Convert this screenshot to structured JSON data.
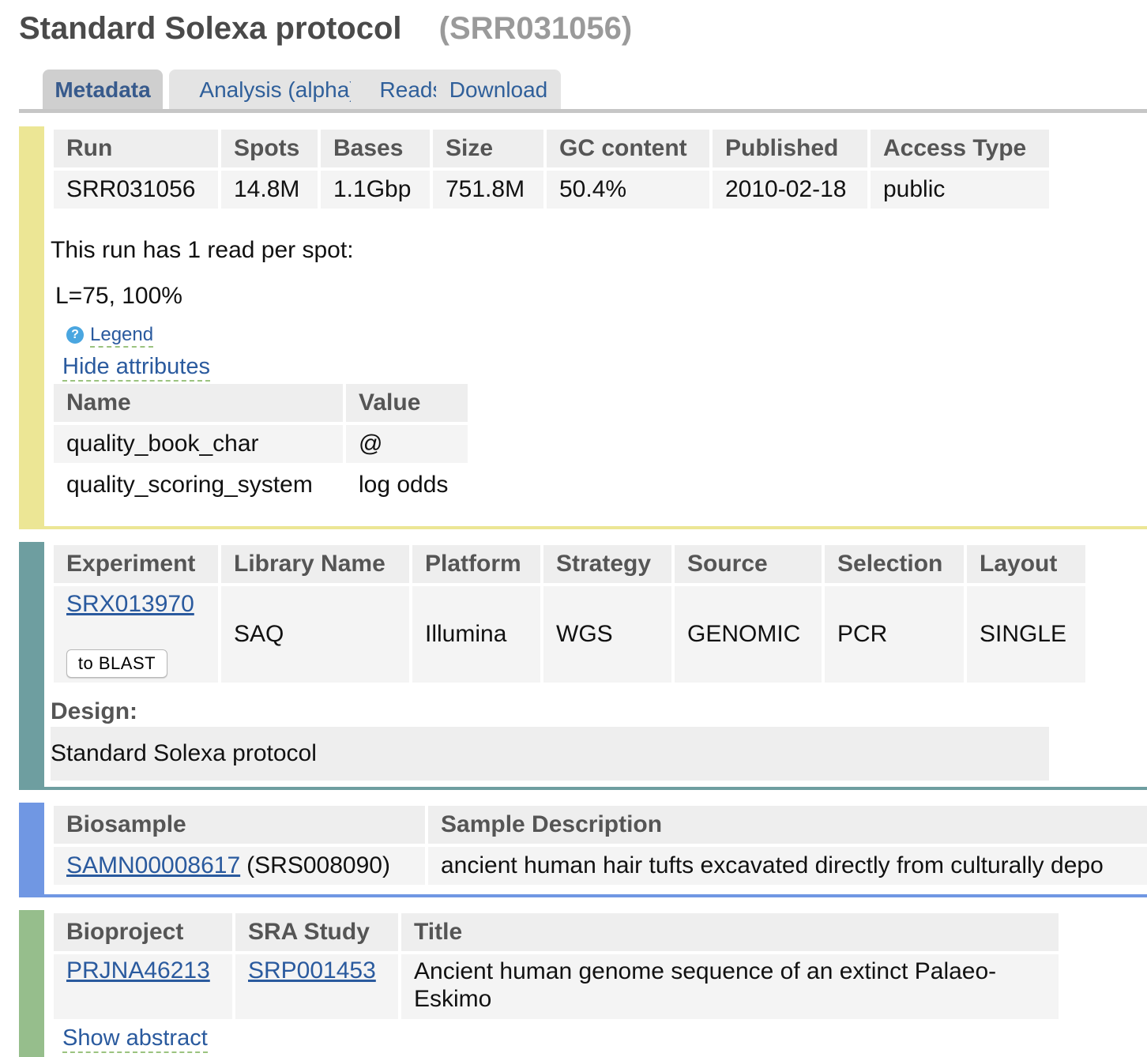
{
  "page": {
    "title": "Standard Solexa protocol",
    "accession": "(SRR031056)"
  },
  "tabs": [
    {
      "label": "Metadata",
      "active": true
    },
    {
      "label": "Analysis (alpha)",
      "active": false
    },
    {
      "label": "Reads",
      "active": false
    },
    {
      "label": "Download",
      "active": false
    }
  ],
  "colors": {
    "run_bar": "#ece695",
    "experiment_bar": "#6e9ea0",
    "biosample_bar": "#7097e3",
    "bioproject_bar": "#96be8c"
  },
  "run": {
    "headers": [
      "Run",
      "Spots",
      "Bases",
      "Size",
      "GC content",
      "Published",
      "Access Type"
    ],
    "values": [
      "SRR031056",
      "14.8M",
      "1.1Gbp",
      "751.8M",
      "50.4%",
      "2010-02-18",
      "public"
    ],
    "reads_per_spot_text": "This run has 1 read per spot:",
    "read_layout": "L=75, 100%",
    "legend_label": "Legend",
    "legend_icon": "help-question-icon",
    "hide_attributes_label": "Hide attributes",
    "attributes": {
      "headers": [
        "Name",
        "Value"
      ],
      "rows": [
        [
          "quality_book_char",
          "@"
        ],
        [
          "quality_scoring_system",
          "log odds"
        ]
      ]
    }
  },
  "experiment": {
    "headers": [
      "Experiment",
      "Library Name",
      "Platform",
      "Strategy",
      "Source",
      "Selection",
      "Layout"
    ],
    "accession": "SRX013970",
    "blast_button": "to BLAST",
    "values": [
      "SAQ",
      "Illumina",
      "WGS",
      "GENOMIC",
      "PCR",
      "SINGLE"
    ],
    "design_label": "Design:",
    "design_text": "Standard Solexa protocol"
  },
  "biosample": {
    "headers": [
      "Biosample",
      "Sample Description"
    ],
    "accession": "SAMN00008617",
    "sra_accession": "(SRS008090)",
    "description": "ancient human hair tufts excavated directly from culturally depo"
  },
  "bioproject": {
    "headers": [
      "Bioproject",
      "SRA Study",
      "Title"
    ],
    "accession": "PRJNA46213",
    "study": "SRP001453",
    "title_line1": "Ancient human genome sequence of an extinct Palaeo-",
    "title_line2": "Eskimo",
    "show_abstract_label": "Show abstract"
  }
}
